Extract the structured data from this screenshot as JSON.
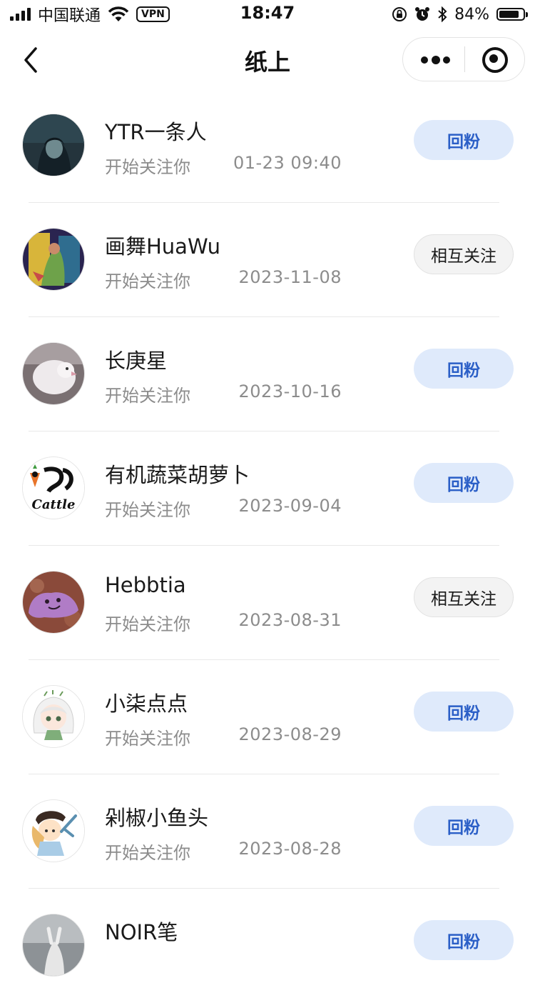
{
  "status_bar": {
    "carrier": "中国联通",
    "vpn": "VPN",
    "time": "18:47",
    "battery": "84%",
    "battery_level": 0.84
  },
  "nav": {
    "title": "纸上"
  },
  "followers": [
    {
      "name": "YTR一条人",
      "subtitle": "开始关注你",
      "time": "01-23 09:40",
      "button": "回粉",
      "state": "follow-back"
    },
    {
      "name": "画舞HuaWu",
      "subtitle": "开始关注你",
      "time": "2023-11-08",
      "button": "相互关注",
      "state": "mutual"
    },
    {
      "name": "长庚星",
      "subtitle": "开始关注你",
      "time": "2023-10-16",
      "button": "回粉",
      "state": "follow-back"
    },
    {
      "name": "有机蔬菜胡萝卜",
      "subtitle": "开始关注你",
      "time": "2023-09-04",
      "button": "回粉",
      "state": "follow-back"
    },
    {
      "name": "Hebbtia",
      "subtitle": "开始关注你",
      "time": "2023-08-31",
      "button": "相互关注",
      "state": "mutual"
    },
    {
      "name": "小柒点点",
      "subtitle": "开始关注你",
      "time": "2023-08-29",
      "button": "回粉",
      "state": "follow-back"
    },
    {
      "name": "剁椒小鱼头",
      "subtitle": "开始关注你",
      "time": "2023-08-28",
      "button": "回粉",
      "state": "follow-back"
    },
    {
      "name": "NOIR笔",
      "subtitle": "",
      "time": "",
      "button": "回粉",
      "state": "follow-back"
    }
  ],
  "colors": {
    "follow_back_bg": "#dfeafb",
    "follow_back_text": "#2b5fc7",
    "mutual_bg": "#f3f3f3",
    "secondary_text": "#8c8c8c"
  }
}
